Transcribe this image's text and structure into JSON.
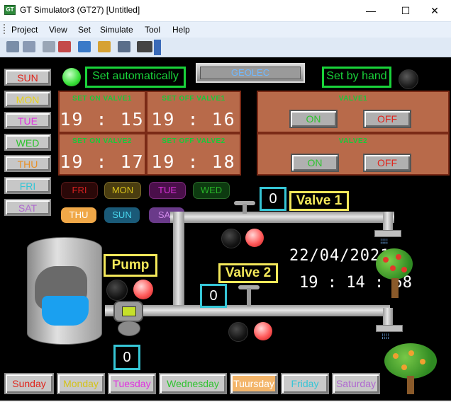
{
  "window": {
    "title": "GT Simulator3 (GT27)  [Untitled]",
    "app_icon_text": "GT",
    "minimize": "—",
    "maximize": "☐",
    "close": "✕"
  },
  "menu": [
    "Project",
    "View",
    "Set",
    "Simulate",
    "Tool",
    "Help"
  ],
  "toolbar_icons": [
    "open-icon",
    "save-icon",
    "print-icon",
    "monitor-icon",
    "simulate-icon",
    "device-icon",
    "screen-icon",
    "keyboard-icon",
    "dropdown-icon"
  ],
  "screen": {
    "left_days": [
      {
        "label": "SUN",
        "color": "#e0241b"
      },
      {
        "label": "MON",
        "color": "#e8d21a"
      },
      {
        "label": "TUE",
        "color": "#e032e0"
      },
      {
        "label": "WED",
        "color": "#2fc32f"
      },
      {
        "label": "THU",
        "color": "#e8912a"
      },
      {
        "label": "FRI",
        "color": "#36c6d6"
      },
      {
        "label": "SAT",
        "color": "#b06ad0"
      }
    ],
    "set_auto": "Set automatically",
    "geolec": "GEOLEC",
    "set_hand": "Set by hand",
    "panels": [
      {
        "title": "SET ON VALVE1",
        "time": "19 : 15"
      },
      {
        "title": "SET OFF VALVE1",
        "time": "19 : 16"
      },
      {
        "title": "SET ON VALVE2",
        "time": "19 : 17"
      },
      {
        "title": "SET OFF VALVE2",
        "time": "19 : 18"
      }
    ],
    "valve_panels": [
      {
        "title": "VALVE1",
        "on": "ON",
        "off": "OFF"
      },
      {
        "title": "VALVE2",
        "on": "ON",
        "off": "OFF"
      }
    ],
    "day_pills": [
      {
        "label": "FRI",
        "bg": "#2a0808",
        "color": "#d42020"
      },
      {
        "label": "MON",
        "bg": "#4a3d10",
        "color": "#d9c21a"
      },
      {
        "label": "TUE",
        "bg": "#4a0f4a",
        "color": "#d830d8"
      },
      {
        "label": "WED",
        "bg": "#0d3a10",
        "color": "#28b428"
      },
      {
        "label": "THU",
        "bg": "#f0a848",
        "color": "#ffffff"
      },
      {
        "label": "SUN",
        "bg": "#1a5a78",
        "color": "#49d6ee"
      },
      {
        "label": "SAT",
        "bg": "#6a3a8a",
        "color": "#d28aea"
      }
    ],
    "valve1_label": "Valve 1",
    "valve1_value": "0",
    "valve2_label": "Valve 2",
    "valve2_value": "0",
    "pump_label": "Pump",
    "pump_value": "0",
    "date": "22/04/2021",
    "time": "19 : 14 : 58",
    "bottom_days": [
      {
        "label": "Sunday",
        "color": "#e0241b",
        "bg": "#c9c9c9"
      },
      {
        "label": "Monday",
        "color": "#d4c31a",
        "bg": "#c9c9c9"
      },
      {
        "label": "Tuesday",
        "color": "#e032e0",
        "bg": "#c9c9c9"
      },
      {
        "label": "Wednesday",
        "color": "#2fc32f",
        "bg": "#c9c9c9"
      },
      {
        "label": "Tuursday",
        "color": "#ffffff",
        "bg": "#f3b56a"
      },
      {
        "label": "Friday",
        "color": "#36c6d6",
        "bg": "#c9c9c9"
      },
      {
        "label": "Saturday",
        "color": "#b06ad0",
        "bg": "#c9c9c9"
      }
    ]
  }
}
